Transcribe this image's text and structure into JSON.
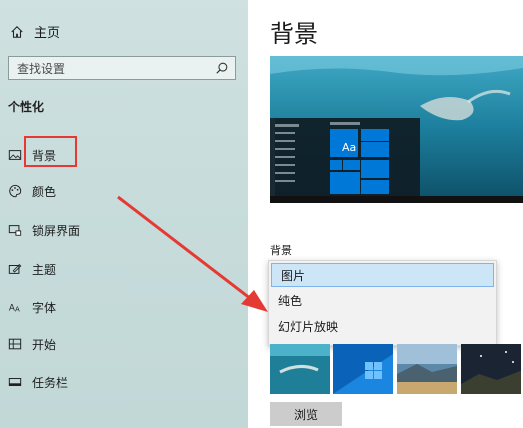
{
  "sidebar": {
    "home_label": "主页",
    "search_placeholder": "查找设置",
    "section_title": "个性化",
    "items": [
      {
        "label": "背景",
        "icon": "picture-icon"
      },
      {
        "label": "颜色",
        "icon": "palette-icon"
      },
      {
        "label": "锁屏界面",
        "icon": "lock-screen-icon"
      },
      {
        "label": "主题",
        "icon": "theme-icon"
      },
      {
        "label": "字体",
        "icon": "font-icon"
      },
      {
        "label": "开始",
        "icon": "start-icon"
      },
      {
        "label": "任务栏",
        "icon": "taskbar-icon"
      }
    ]
  },
  "main": {
    "title": "背景",
    "preview_tile_text": "Aa",
    "background_label": "背景",
    "dropdown_options": [
      "图片",
      "纯色",
      "幻灯片放映"
    ],
    "dropdown_selected": "图片",
    "browse_label": "浏览"
  },
  "colors": {
    "accent": "#0078d7",
    "highlight_box": "#e53935",
    "arrow": "#e53935"
  }
}
